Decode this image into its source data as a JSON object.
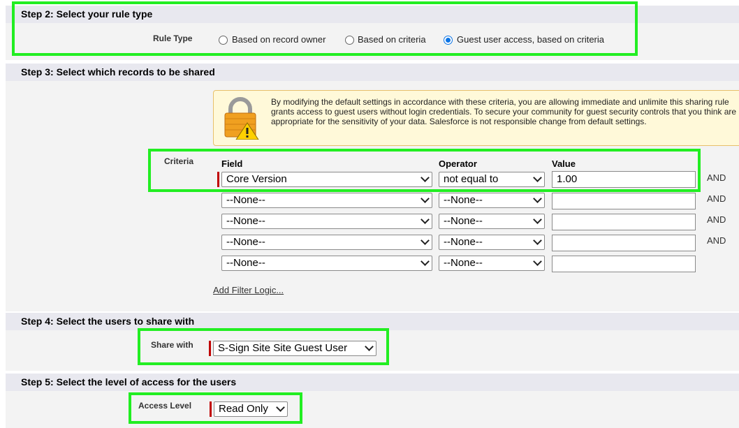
{
  "step2": {
    "title": "Step 2: Select your rule type",
    "rule_type_label": "Rule Type",
    "options": [
      {
        "label": "Based on record owner",
        "checked": false
      },
      {
        "label": "Based on criteria",
        "checked": false
      },
      {
        "label": "Guest user access, based on criteria",
        "checked": true
      }
    ]
  },
  "step3": {
    "title": "Step 3: Select which records to be shared",
    "warning": "By modifying the default settings in accordance with these criteria, you are allowing immediate and unlimite this sharing rule grants access to guest users without login credentials. To secure your community for guest security controls that you think are appropriate for the sensitivity of your data. Salesforce is not responsible change from default settings.",
    "warning_icon": "lock-warning-icon",
    "criteria_label": "Criteria",
    "columns": {
      "field": "Field",
      "operator": "Operator",
      "value": "Value"
    },
    "rows": [
      {
        "field": "Core Version",
        "operator": "not equal to",
        "value": "1.00",
        "conj": "AND"
      },
      {
        "field": "--None--",
        "operator": "--None--",
        "value": "",
        "conj": "AND"
      },
      {
        "field": "--None--",
        "operator": "--None--",
        "value": "",
        "conj": "AND"
      },
      {
        "field": "--None--",
        "operator": "--None--",
        "value": "",
        "conj": "AND"
      },
      {
        "field": "--None--",
        "operator": "--None--",
        "value": "",
        "conj": ""
      }
    ],
    "filter_logic_link": "Add Filter Logic..."
  },
  "step4": {
    "title": "Step 4: Select the users to share with",
    "share_with_label": "Share with",
    "share_with_value": "S-Sign Site Site Guest User"
  },
  "step5": {
    "title": "Step 5: Select the level of access for the users",
    "access_level_label": "Access Level",
    "access_level_value": "Read Only"
  },
  "colors": {
    "highlight": "#22ee22",
    "required": "#c00000",
    "radio_selected": "#0b74e5",
    "section_header_bg": "#e8e8ef",
    "warning_bg": "#fff9d9"
  }
}
